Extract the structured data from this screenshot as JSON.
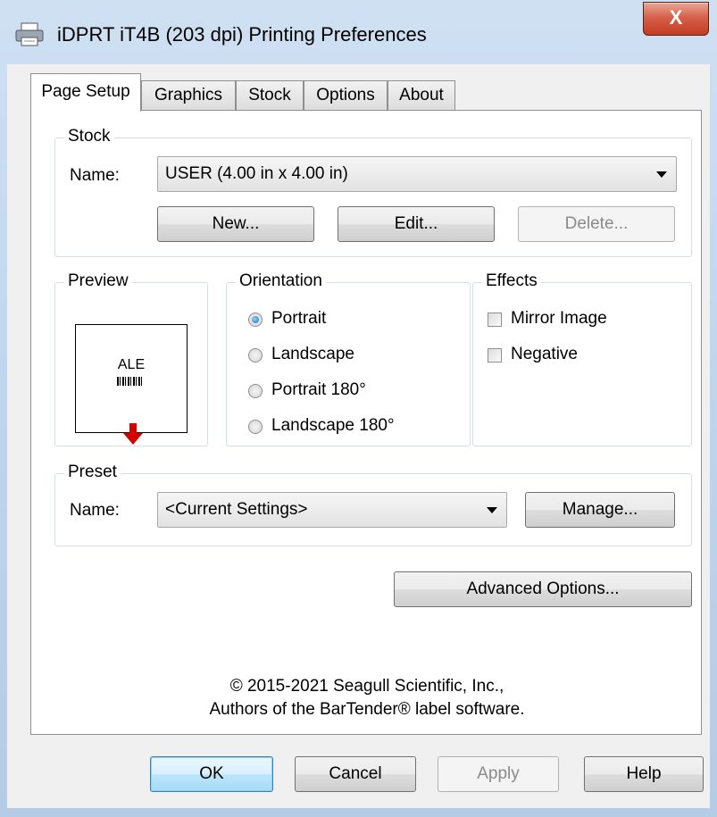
{
  "window": {
    "title": "iDPRT iT4B (203 dpi) Printing Preferences",
    "close_label": "X"
  },
  "tabs": [
    {
      "label": "Page Setup",
      "active": true
    },
    {
      "label": "Graphics",
      "active": false
    },
    {
      "label": "Stock",
      "active": false
    },
    {
      "label": "Options",
      "active": false
    },
    {
      "label": "About",
      "active": false
    }
  ],
  "stock": {
    "group_label": "Stock",
    "name_label": "Name:",
    "name_value": "USER (4.00 in x 4.00 in)",
    "new_label": "New...",
    "edit_label": "Edit...",
    "delete_label": "Delete..."
  },
  "preview": {
    "group_label": "Preview",
    "sample_text": "ALE"
  },
  "orientation": {
    "group_label": "Orientation",
    "options": [
      "Portrait",
      "Landscape",
      "Portrait 180°",
      "Landscape 180°"
    ],
    "selected": "Portrait"
  },
  "effects": {
    "group_label": "Effects",
    "mirror_label": "Mirror Image",
    "negative_label": "Negative"
  },
  "preset": {
    "group_label": "Preset",
    "name_label": "Name:",
    "name_value": "<Current Settings>",
    "manage_label": "Manage..."
  },
  "advanced_label": "Advanced Options...",
  "copyright": {
    "line1": "© 2015-2021 Seagull Scientific, Inc.,",
    "line2": "Authors of the BarTender® label software."
  },
  "footer": {
    "ok_label": "OK",
    "cancel_label": "Cancel",
    "apply_label": "Apply",
    "help_label": "Help"
  },
  "colors": {
    "accent": "#3c7fb1",
    "close_red": "#c23c22",
    "preview_arrow": "#d40000"
  }
}
